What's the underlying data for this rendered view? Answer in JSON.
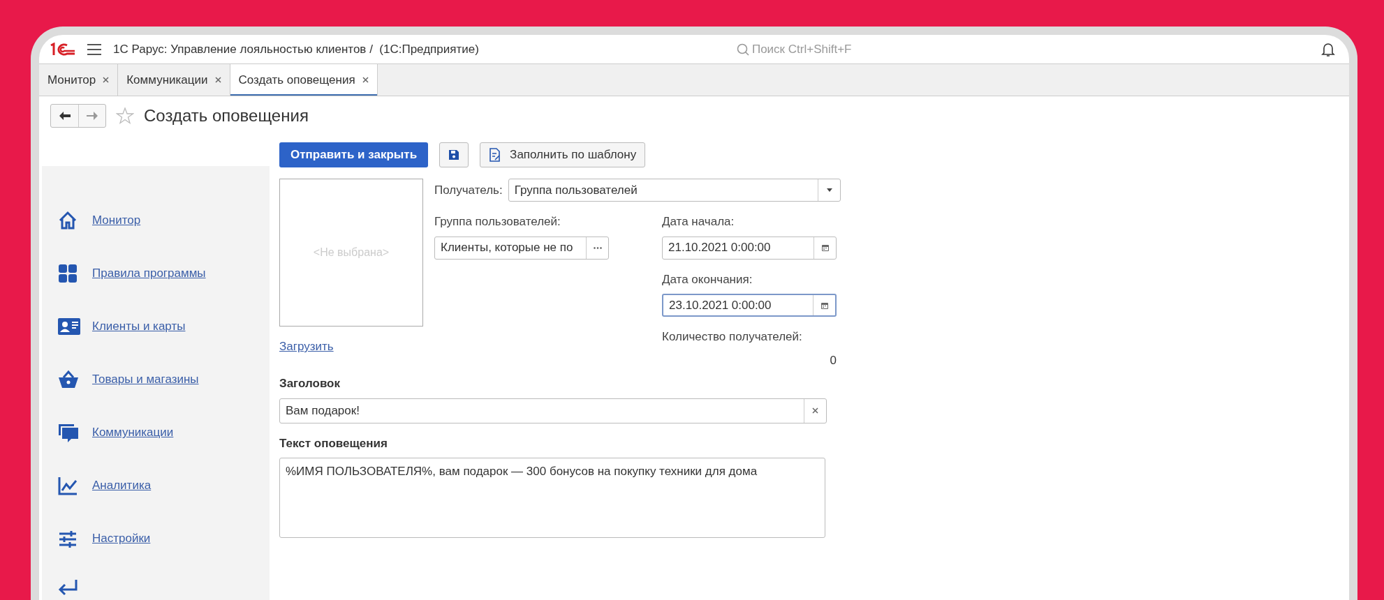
{
  "window": {
    "title": "1С Рарус: Управление лояльностью клиентов /  (1С:Предприятие)",
    "search_placeholder": "Поиск Ctrl+Shift+F"
  },
  "tabs": [
    {
      "label": "Монитор",
      "selected": false
    },
    {
      "label": "Коммуникации",
      "selected": false
    },
    {
      "label": "Создать оповещения",
      "selected": true
    }
  ],
  "page": {
    "title": "Создать оповещения",
    "favorite": false
  },
  "toolbar": {
    "primary_button": "Отправить и закрыть",
    "template_button": "Заполнить по шаблону"
  },
  "sidebar": {
    "items": [
      {
        "label": "Монитор",
        "kind": "home"
      },
      {
        "label": "Правила программы",
        "kind": "grid"
      },
      {
        "label": "Клиенты и карты",
        "kind": "card"
      },
      {
        "label": "Товары и магазины",
        "kind": "basket"
      },
      {
        "label": "Коммуникации",
        "kind": "chat"
      },
      {
        "label": "Аналитика",
        "kind": "chart"
      },
      {
        "label": "Настройки",
        "kind": "sliders"
      }
    ]
  },
  "form": {
    "picture_placeholder": "<Не выбрана>",
    "load_link": "Загрузить",
    "recipient_label": "Получатель:",
    "recipient_value": "Группа пользователей",
    "group_label": "Группа пользователей:",
    "group_value": "Клиенты, которые не по",
    "start_label": "Дата начала:",
    "start_value": "21.10.2021  0:00:00",
    "start_focused": false,
    "end_label": "Дата окончания:",
    "end_value": "23.10.2021  0:00:00",
    "end_focused": true,
    "count_label": "Количество получателей:",
    "count_value": "0",
    "subject_label": "Заголовок",
    "subject_value": "Вам подарок!",
    "body_label": "Текст оповещения",
    "body_value": "%ИМЯ ПОЛЬЗОВАТЕЛЯ%, вам подарок — 300 бонусов на покупку техники для дома"
  }
}
